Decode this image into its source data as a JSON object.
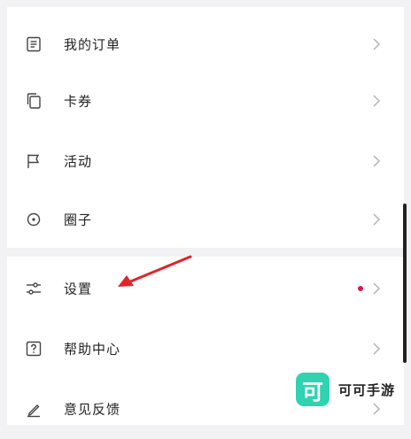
{
  "menu": {
    "items": [
      {
        "label": "我的订单",
        "icon": "document-list-icon"
      },
      {
        "label": "卡券",
        "icon": "copy-cards-icon"
      },
      {
        "label": "活动",
        "icon": "flag-icon"
      },
      {
        "label": "圈子",
        "icon": "circle-dot-icon"
      },
      {
        "label": "设置",
        "icon": "sliders-icon",
        "badge_dot": true
      },
      {
        "label": "帮助中心",
        "icon": "question-box-icon"
      },
      {
        "label": "意见反馈",
        "icon": "pencil-icon"
      }
    ]
  },
  "annotation": {
    "arrow_color": "#e0242b"
  },
  "watermark": {
    "logo_char": "可",
    "text": "可可手游",
    "logo_color": "#2fd3b0"
  },
  "colors": {
    "badge_dot": "#d81b4b",
    "background": "#f2f2f4"
  }
}
